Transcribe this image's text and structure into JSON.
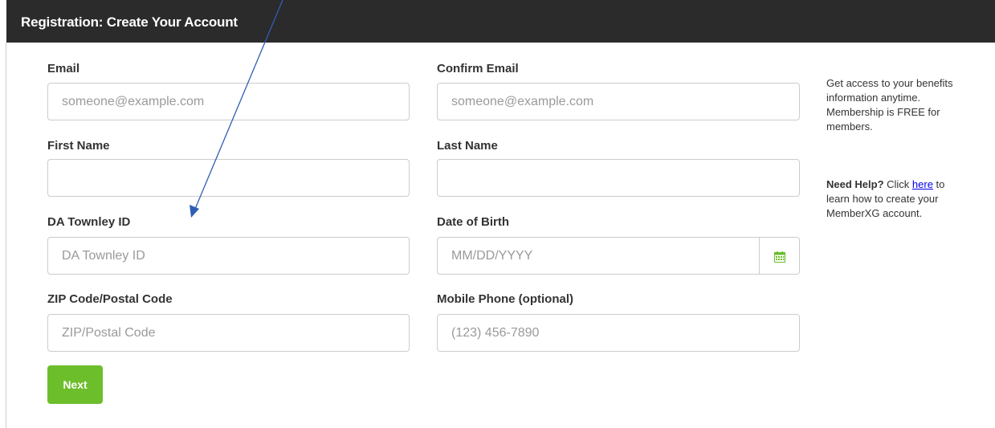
{
  "header": {
    "title": "Registration: Create Your Account"
  },
  "form": {
    "email": {
      "label": "Email",
      "placeholder": "someone@example.com",
      "value": ""
    },
    "confirm_email": {
      "label": "Confirm Email",
      "placeholder": "someone@example.com",
      "value": ""
    },
    "first_name": {
      "label": "First Name",
      "placeholder": "",
      "value": ""
    },
    "last_name": {
      "label": "Last Name",
      "placeholder": "",
      "value": ""
    },
    "townley_id": {
      "label": "DA Townley ID",
      "placeholder": "DA Townley ID",
      "value": ""
    },
    "dob": {
      "label": "Date of Birth",
      "placeholder": "MM/DD/YYYY",
      "value": "",
      "icon": "calendar-icon"
    },
    "zip": {
      "label": "ZIP Code/Postal Code",
      "placeholder": "ZIP/Postal Code",
      "value": ""
    },
    "mobile": {
      "label": "Mobile Phone (optional)",
      "placeholder": "(123) 456-7890",
      "value": ""
    },
    "next_label": "Next"
  },
  "sidebar": {
    "info_text": "Get access to your benefits information anytime. Membership is FREE for members.",
    "help_strong": "Need Help?",
    "help_pre": " Click ",
    "help_link": "here",
    "help_post": " to learn how to create your MemberXG account."
  },
  "colors": {
    "header_bg": "#2b2b2b",
    "next_button": "#6cbe2b",
    "calendar_icon": "#6cbe2b",
    "link": "#0000ee",
    "annotation_arrow": "#2f5fb3"
  }
}
